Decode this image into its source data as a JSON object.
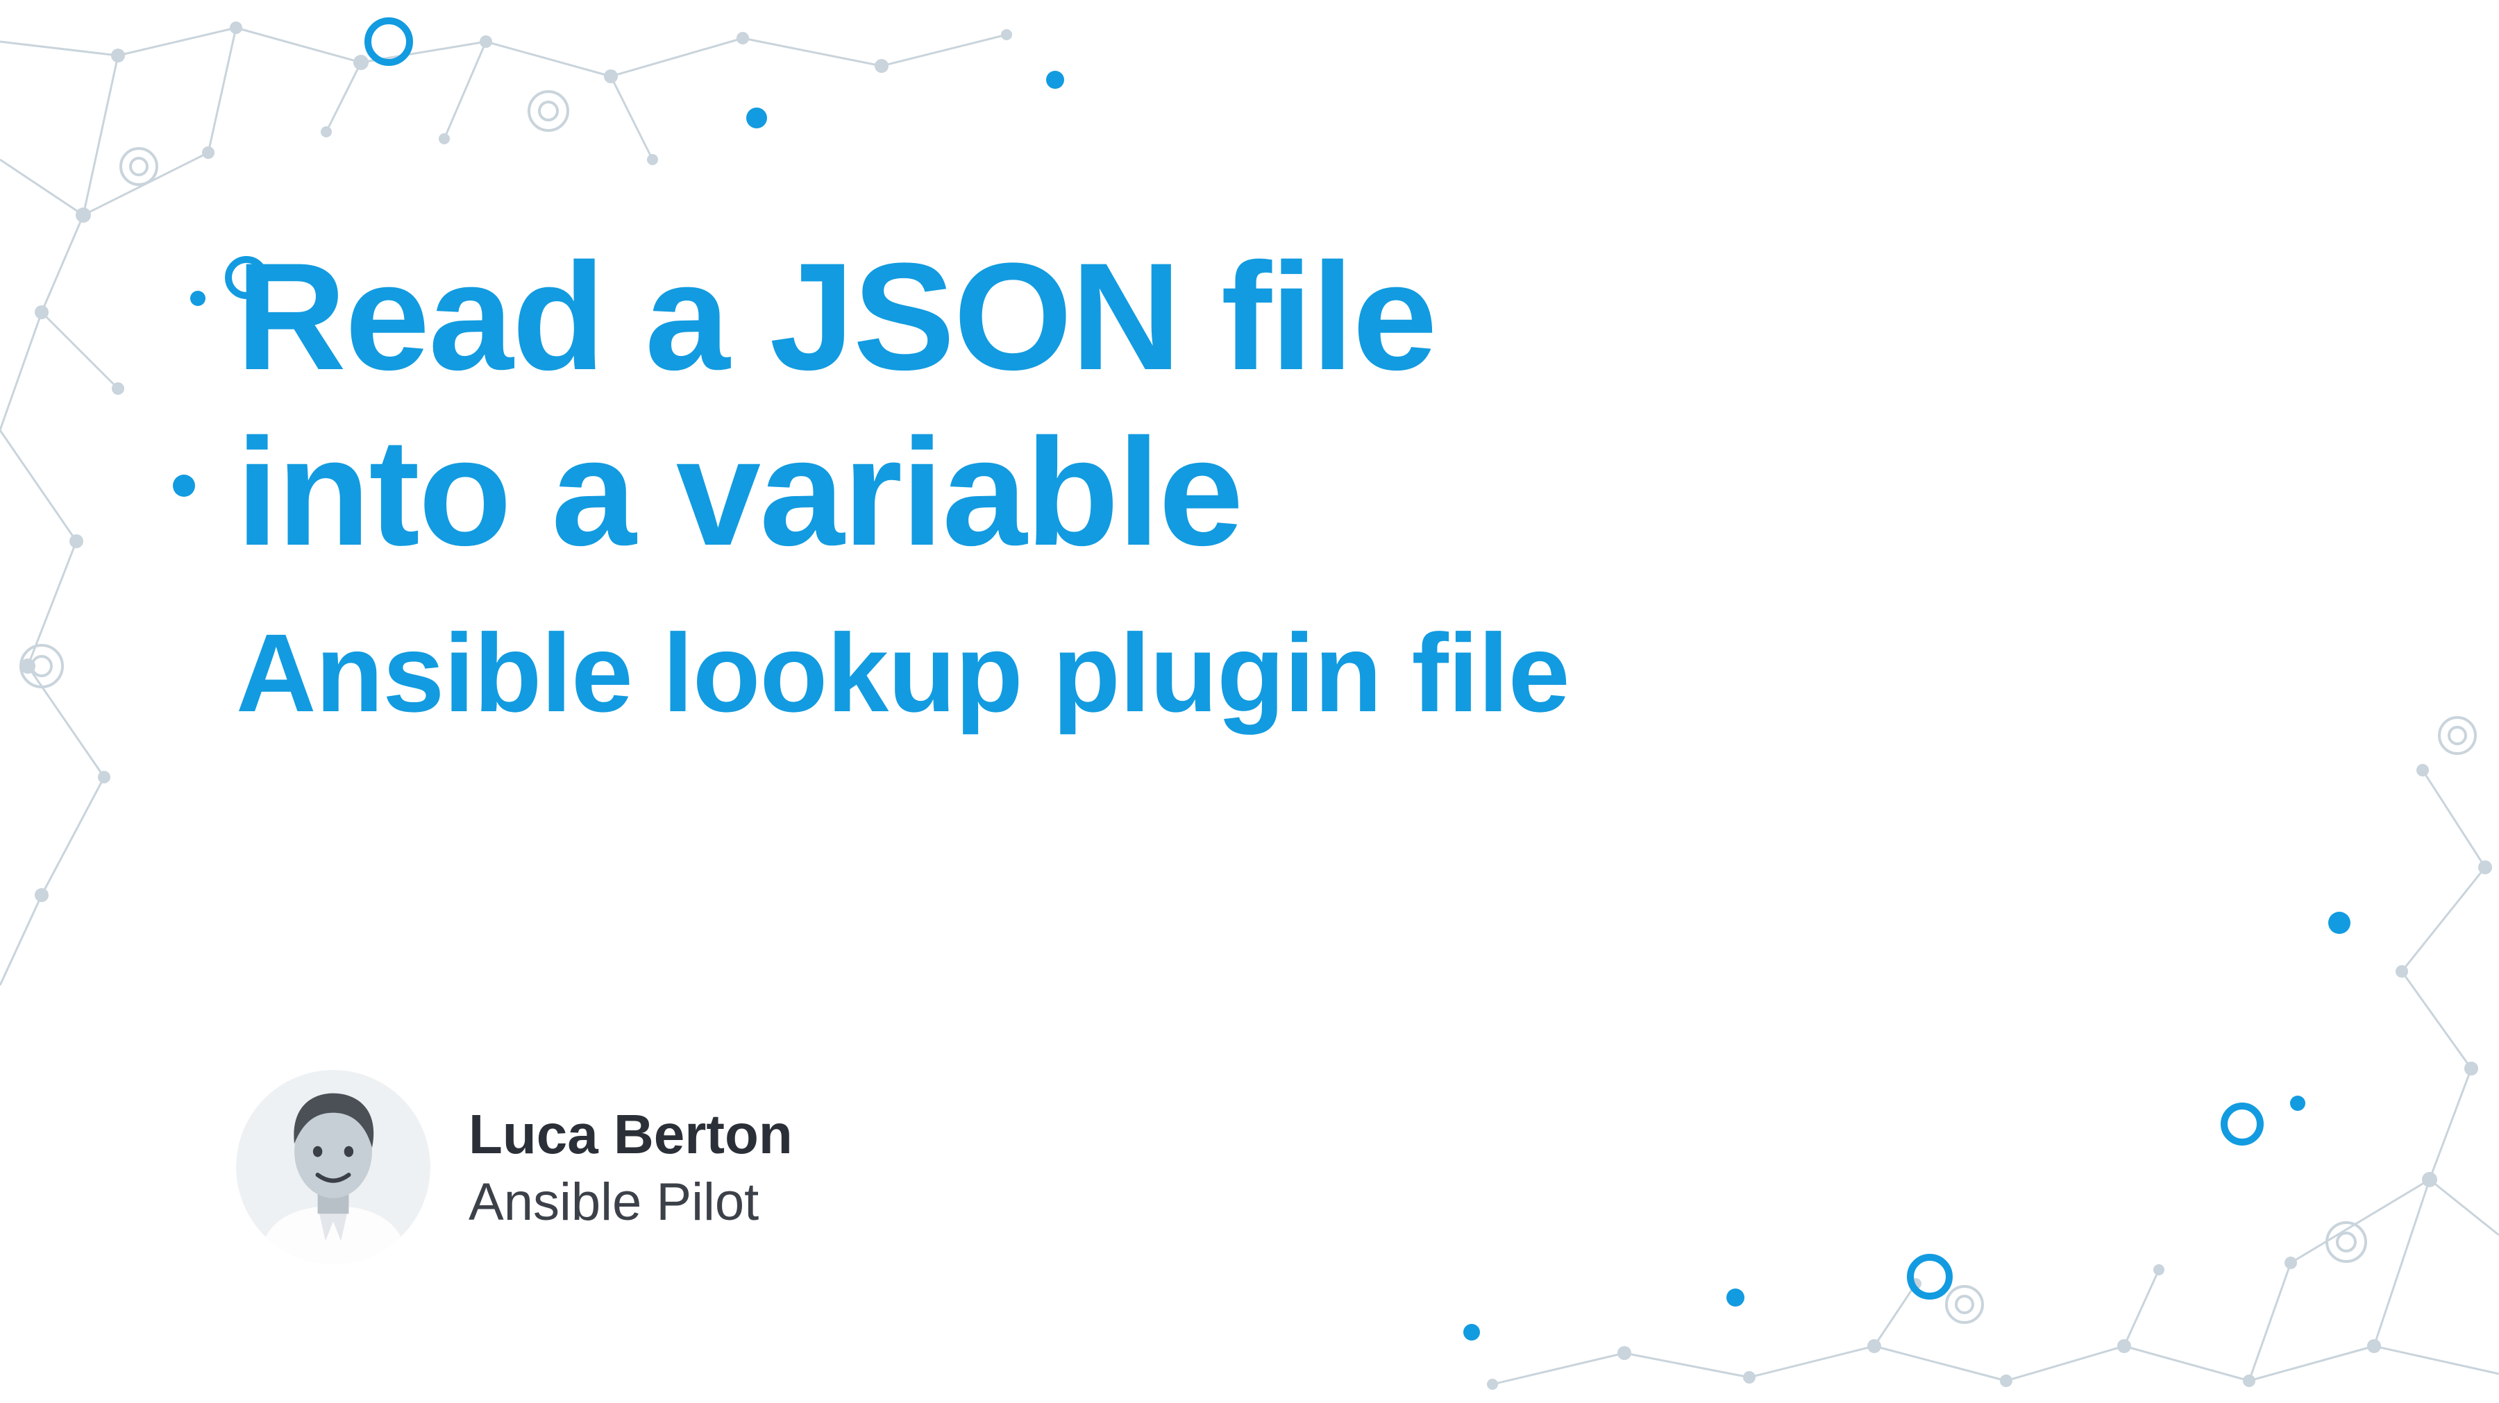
{
  "title": {
    "line1": "Read a JSON file",
    "line2": "into a variable",
    "subtitle": "Ansible lookup plugin file"
  },
  "author": {
    "name": "Luca Berton",
    "role": "Ansible Pilot"
  },
  "colors": {
    "accent": "#129be0",
    "network_gray": "#b9c6d0",
    "network_blue": "#129be0",
    "text_dark": "#2b3038"
  }
}
